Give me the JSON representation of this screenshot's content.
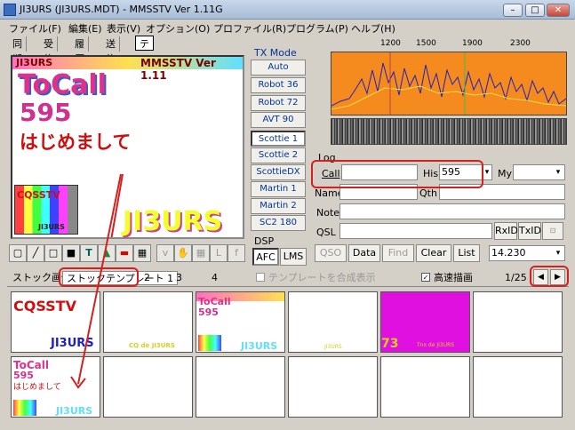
{
  "window": {
    "title": "JI3URS (JI3URS.MDT) - MMSSTV Ver 1.11G",
    "min_label": "–",
    "max_label": "□",
    "close_label": "✕"
  },
  "menu": [
    "ファイル(F)",
    "編集(E)",
    "表示(V)",
    "オプション(O)",
    "プロファイル(R)",
    "プログラム(P)",
    "ヘルプ(H)"
  ],
  "top_tabs": [
    "同期",
    "受信",
    "履歴",
    "送信",
    "テンプレート"
  ],
  "preview": {
    "callsign": "JI3URS",
    "version": "MMSSTV Ver 1.11",
    "tocall": "ToCall",
    "rsv": "595",
    "greeting": "はじめまして",
    "thumb_label": "CQSSTV",
    "thumb_call": "JI3URS",
    "big_call": "JI3URS"
  },
  "tx_mode": {
    "label": "TX Mode",
    "buttons": [
      "Auto",
      "Robot 36",
      "Robot 72",
      "AVT 90",
      "Scottie 1",
      "Scottie 2",
      "ScottieDX",
      "Martin 1",
      "Martin 2",
      "SC2 180"
    ],
    "selected": "Scottie 1"
  },
  "dsp": {
    "label": "DSP",
    "afc": "AFC",
    "lms": "LMS"
  },
  "ruler": [
    "1200",
    "1500",
    "1900",
    "2300"
  ],
  "log": {
    "label": "Log",
    "call_label": "Call",
    "call_value": "",
    "his_label": "His",
    "his_value": "595",
    "my_label": "My",
    "my_value": "",
    "name_label": "Name",
    "qth_label": "Qth",
    "note_label": "Note",
    "qsl_label": "QSL",
    "rxid": "RxID",
    "txid": "TxID",
    "buttons": [
      "QSO",
      "Data",
      "Find",
      "Clear",
      "List"
    ],
    "freq": "14.230"
  },
  "stock": {
    "label": "ストック画像",
    "tabs": [
      "ストックテンプレート 1",
      "2",
      "3",
      "4"
    ],
    "compose_label": "テンプレートを合成表示",
    "fast_label": "高速描画",
    "page": "1/25"
  },
  "cells": [
    {
      "title": "CQSSTV",
      "call": "JI3URS"
    },
    {
      "title": "",
      "call": "CQ de JI3URS"
    },
    {
      "title": "ToCall",
      "rsv": "595",
      "call": "JI3URS"
    },
    {
      "title": "",
      "call": "JI3URS"
    },
    {
      "title": "73",
      "call": "Tnx de JI3URS"
    },
    {
      "title": "",
      "call": ""
    },
    {
      "title": "ToCall",
      "rsv": "595",
      "greeting": "はじめまして",
      "call": "JI3URS"
    }
  ],
  "colors": {
    "accent_red": "#d52020",
    "waterfall": "#f58a1e"
  }
}
